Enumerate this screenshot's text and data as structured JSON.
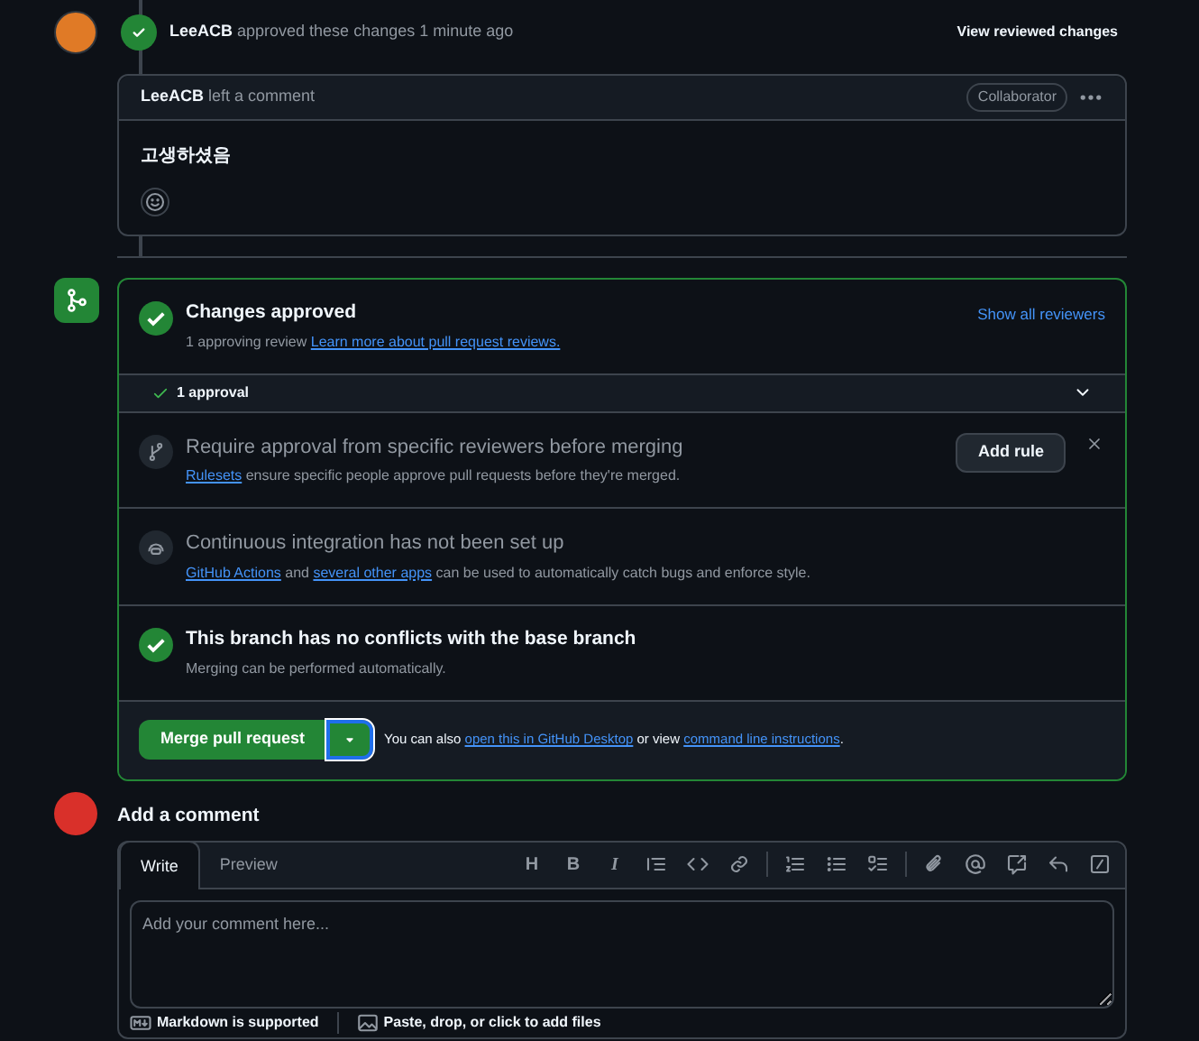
{
  "review": {
    "author": "LeeACB",
    "action": "approved these changes 1 minute ago",
    "link": "View reviewed changes"
  },
  "comment": {
    "author": "LeeACB",
    "action": "left a comment",
    "badge": "Collaborator",
    "body": "고생하셨음"
  },
  "merge": {
    "sections": [
      {
        "kind": "status",
        "title": "Changes approved",
        "text": [
          {
            "text": "1 approving review "
          },
          {
            "text": "Learn more about pull request reviews.",
            "link": true
          }
        ],
        "action": "Show all reviewers"
      },
      {
        "kind": "approvals",
        "label": "1 approval",
        "expanded": false
      },
      {
        "kind": "rule",
        "title": "Require approval from specific reviewers before merging",
        "text": [
          {
            "text": "Rulesets",
            "link": true
          },
          {
            "text": " ensure specific people approve pull requests before they're merged."
          }
        ],
        "button": "Add rule"
      },
      {
        "kind": "ci",
        "title": "Continuous integration has not been set up",
        "text": [
          {
            "text": "GitHub Actions",
            "link": true
          },
          {
            "text": " and "
          },
          {
            "text": "several other apps",
            "link": true
          },
          {
            "text": " can be used to automatically catch bugs and enforce style."
          }
        ]
      },
      {
        "kind": "status",
        "title": "This branch has no conflicts with the base branch",
        "text": [
          {
            "text": "Merging can be performed automatically."
          }
        ]
      }
    ],
    "button": "Merge pull request",
    "note": [
      {
        "text": "You can also "
      },
      {
        "text": "open this in GitHub Desktop",
        "link": true
      },
      {
        "text": " or view "
      },
      {
        "text": "command line instructions",
        "link": true
      },
      {
        "text": "."
      }
    ]
  },
  "new_comment": {
    "title": "Add a comment",
    "tabs": [
      {
        "label": "Write",
        "selected": true
      },
      {
        "label": "Preview",
        "selected": false
      }
    ],
    "toolbar": [
      {
        "kind": "text",
        "label": "H"
      },
      {
        "kind": "text",
        "label": "B"
      },
      {
        "kind": "text",
        "label": "I",
        "italic": true
      },
      {
        "kind": "quote"
      },
      {
        "kind": "code"
      },
      {
        "kind": "link"
      },
      {
        "kind": "sep"
      },
      {
        "kind": "ol"
      },
      {
        "kind": "ul"
      },
      {
        "kind": "tasks"
      },
      {
        "kind": "sep"
      },
      {
        "kind": "attach"
      },
      {
        "kind": "mention"
      },
      {
        "kind": "reference"
      },
      {
        "kind": "reply"
      },
      {
        "kind": "slash"
      }
    ],
    "placeholder": "Add your comment here...",
    "footer": [
      "Markdown is supported",
      "Paste, drop, or click to add files"
    ]
  }
}
